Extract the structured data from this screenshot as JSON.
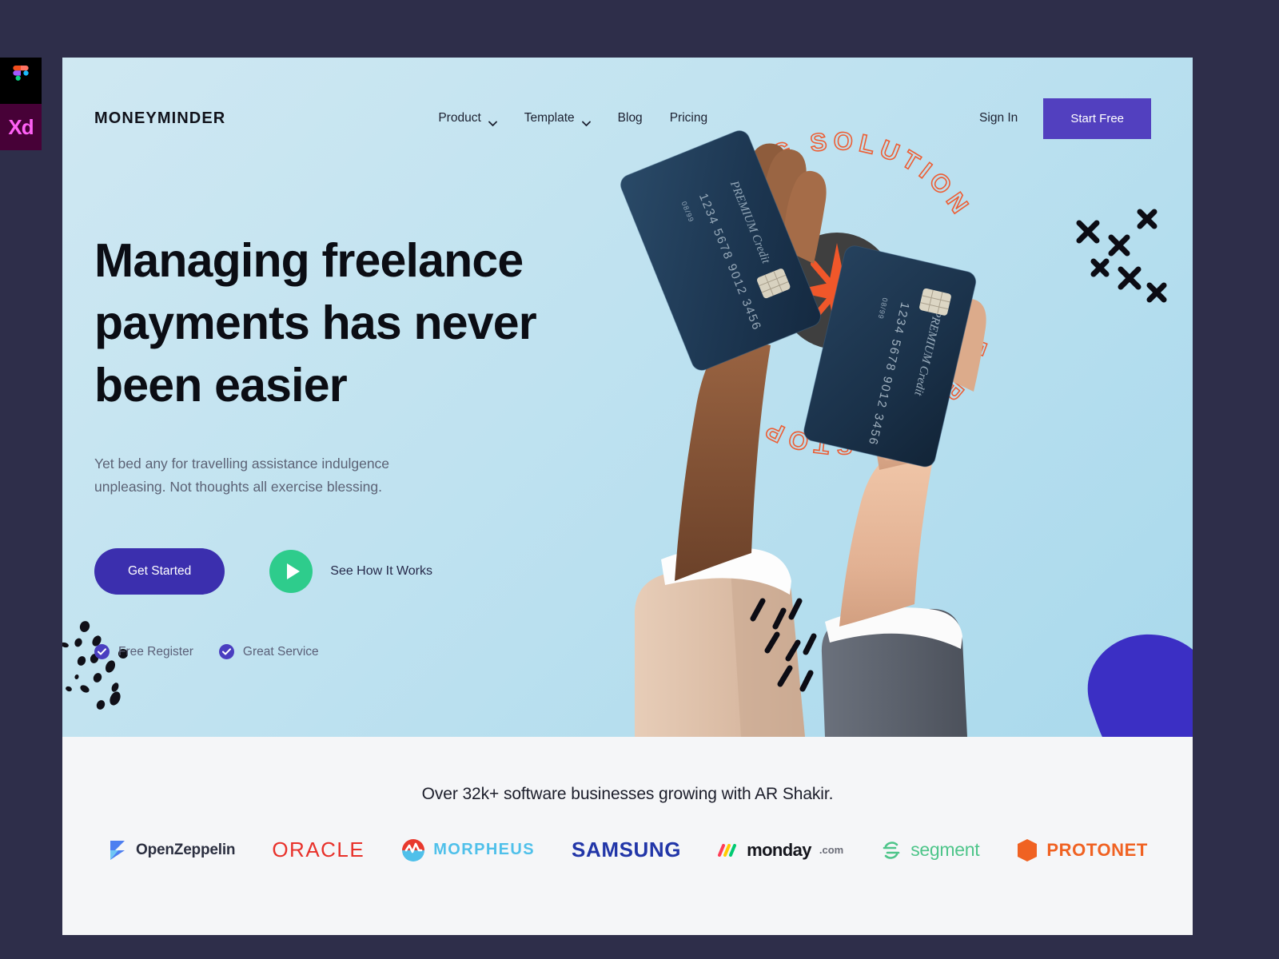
{
  "app_rail": {
    "items": [
      {
        "name": "figma",
        "label": ""
      },
      {
        "name": "adobe-xd",
        "label": "Xd"
      }
    ]
  },
  "header": {
    "brand": "MONEYMINDER",
    "nav_links": [
      {
        "label": "Product",
        "has_dropdown": true
      },
      {
        "label": "Template",
        "has_dropdown": true
      },
      {
        "label": "Blog",
        "has_dropdown": false
      },
      {
        "label": "Pricing",
        "has_dropdown": false
      }
    ],
    "sign_in": "Sign In",
    "start_free": "Start Free"
  },
  "hero": {
    "headline": "Managing freelance payments has never been easier",
    "subtitle": "Yet bed any for travelling assistance indulgence unpleasing. Not thoughts all exercise blessing.",
    "primary_cta": "Get Started",
    "secondary_cta": "See How It Works",
    "features": [
      {
        "label": "Free Register"
      },
      {
        "label": "Great Service"
      }
    ],
    "badge_text": "BANKING SOLUTION FOR ONE STOP",
    "card_label": "PREMIUM Credit",
    "card_number": "1234 5678 9012 3456",
    "card_expiry": "08/99"
  },
  "social_proof": {
    "title": "Over 32k+ software  businesses growing with AR Shakir.",
    "logos": [
      {
        "name": "openzeppelin",
        "text": "OpenZeppelin"
      },
      {
        "name": "oracle",
        "text": "ORACLE"
      },
      {
        "name": "morpheus",
        "text": "MORPHEUS"
      },
      {
        "name": "samsung",
        "text": "SAMSUNG"
      },
      {
        "name": "monday",
        "text": "monday",
        "suffix": ".com"
      },
      {
        "name": "segment",
        "text": "segment"
      },
      {
        "name": "protonet",
        "text": "PROTONET"
      }
    ]
  },
  "colors": {
    "page_bg": "#2e2e4a",
    "hero_bg_start": "#cfe8f2",
    "hero_bg_end": "#a9d9ec",
    "accent_purple": "#5240bf",
    "cta_indigo": "#3b2fae",
    "play_green": "#2ecc8c",
    "badge_orange": "#f0572a",
    "band_bg": "#f5f6f8"
  }
}
